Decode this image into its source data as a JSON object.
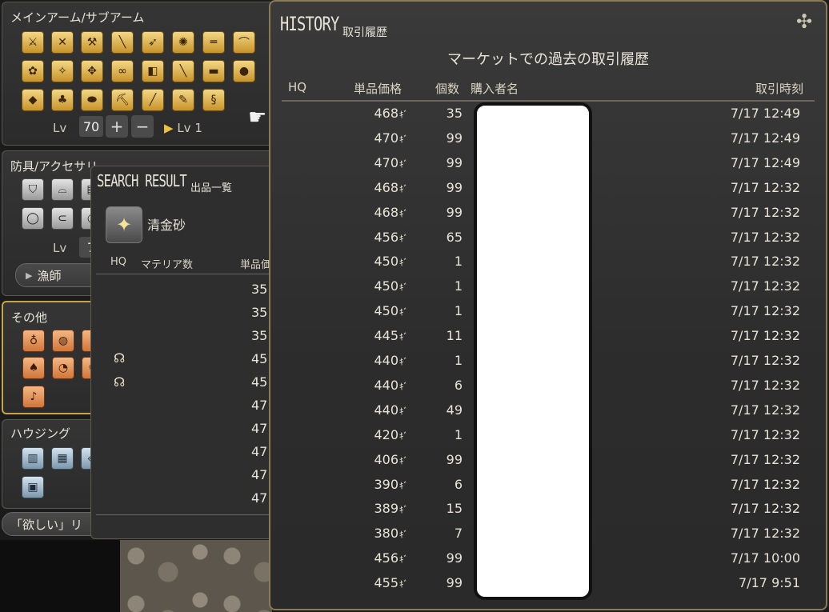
{
  "left_panel": {
    "weapons_title": "メインアーム/サブアーム",
    "lv_label": "Lv",
    "lv_value": "70",
    "lv_plus": "+",
    "lv_minus": "−",
    "lv_current": "Lv 1",
    "armor_title": "防具/アクセサリ",
    "armor_lv_label": "Lv",
    "armor_lv_value": "7",
    "job_dropdown": "漁師",
    "other_title": "その他",
    "housing_title": "ハウジング",
    "wishlist_button": "「欲しい」リ"
  },
  "search_result": {
    "title": "SEARCH RESULT",
    "subtitle": "出品一覧",
    "item_name": "清金砂",
    "col_hq": "HQ",
    "col_materia": "マテリア数",
    "col_price": "単品価",
    "prices": [
      "35",
      "35",
      "35",
      "45",
      "45",
      "47",
      "47",
      "47",
      "47",
      "47"
    ]
  },
  "history": {
    "title": "HISTORY",
    "subtitle": "取引履歴",
    "heading": "マーケットでの過去の取引履歴",
    "col_hq": "HQ",
    "col_price": "単品価格",
    "col_qty": "個数",
    "col_buyer": "購入者名",
    "col_time": "取引時刻",
    "gil_symbol": "ｷﾞ",
    "rows": [
      {
        "price": "468",
        "qty": "35",
        "time": "7/17 12:49"
      },
      {
        "price": "470",
        "qty": "99",
        "time": "7/17 12:49"
      },
      {
        "price": "470",
        "qty": "99",
        "time": "7/17 12:49"
      },
      {
        "price": "468",
        "qty": "99",
        "time": "7/17 12:32"
      },
      {
        "price": "468",
        "qty": "99",
        "time": "7/17 12:32"
      },
      {
        "price": "456",
        "qty": "65",
        "time": "7/17 12:32"
      },
      {
        "price": "450",
        "qty": "1",
        "time": "7/17 12:32"
      },
      {
        "price": "450",
        "qty": "1",
        "time": "7/17 12:32"
      },
      {
        "price": "450",
        "qty": "1",
        "time": "7/17 12:32"
      },
      {
        "price": "445",
        "qty": "11",
        "time": "7/17 12:32"
      },
      {
        "price": "440",
        "qty": "1",
        "time": "7/17 12:32"
      },
      {
        "price": "440",
        "qty": "6",
        "time": "7/17 12:32"
      },
      {
        "price": "440",
        "qty": "49",
        "time": "7/17 12:32"
      },
      {
        "price": "420",
        "qty": "1",
        "time": "7/17 12:32"
      },
      {
        "price": "406",
        "qty": "99",
        "time": "7/17 12:32"
      },
      {
        "price": "390",
        "qty": "6",
        "time": "7/17 12:32"
      },
      {
        "price": "389",
        "qty": "15",
        "time": "7/17 12:32"
      },
      {
        "price": "380",
        "qty": "7",
        "time": "7/17 12:32"
      },
      {
        "price": "456",
        "qty": "99",
        "time": "7/17 10:00"
      },
      {
        "price": "455",
        "qty": "99",
        "time": "7/17 9:51"
      }
    ]
  },
  "colors": {
    "accent_gold": "#c8932b",
    "frame_gold": "#8a7a55",
    "text": "#e8e4d8"
  }
}
